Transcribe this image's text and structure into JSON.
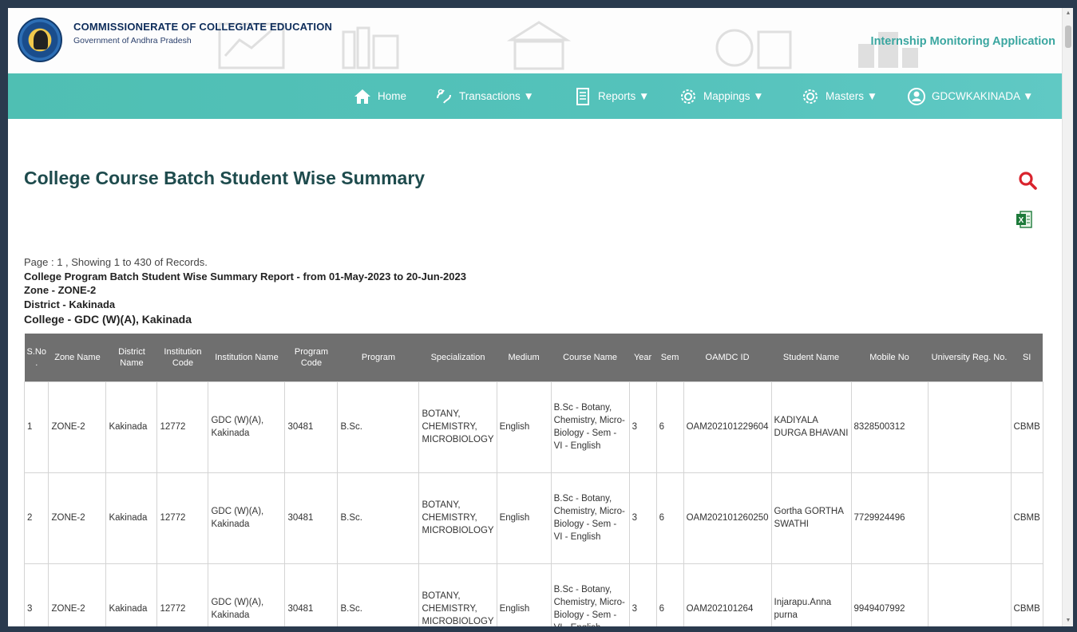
{
  "header": {
    "org_title": "COMMISSIONERATE OF COLLEGIATE EDUCATION",
    "org_subtitle": "Government of Andhra Pradesh",
    "app_title": "Internship Monitoring Application"
  },
  "nav": {
    "items": [
      {
        "label": "Home",
        "icon": "home-icon"
      },
      {
        "label": "Transactions ▼",
        "icon": "transactions-icon"
      },
      {
        "label": "Reports ▼",
        "icon": "reports-icon"
      },
      {
        "label": "Mappings ▼",
        "icon": "gear-icon"
      },
      {
        "label": "Masters ▼",
        "icon": "gear-icon"
      },
      {
        "label": "GDCWKAKINADA ▼",
        "icon": "user-icon"
      }
    ]
  },
  "page": {
    "title": "College Course Batch Student Wise Summary",
    "records_info": "Page : 1 , Showing 1 to 430 of Records.",
    "report_title": "College Program Batch Student Wise Summary Report - from 01-May-2023 to 20-Jun-2023",
    "zone": "Zone - ZONE-2",
    "district": "District - Kakinada",
    "college": "College - GDC (W)(A), Kakinada"
  },
  "table": {
    "headers": [
      "S.No .",
      "Zone Name",
      "District Name",
      "Institution Code",
      "Institution Name",
      "Program Code",
      "Program",
      "Specialization",
      "Medium",
      "Course Name",
      "Year",
      "Sem",
      "OAMDC ID",
      "Student Name",
      "Mobile No",
      "University Reg. No.",
      "SI"
    ],
    "rows": [
      [
        "1",
        "ZONE-2",
        "Kakinada",
        "12772",
        "GDC (W)(A), Kakinada",
        "30481",
        "B.Sc.",
        "BOTANY, CHEMISTRY, MICROBIOLOGY",
        "English",
        "B.Sc - Botany, Chemistry, Micro-Biology - Sem - VI - English",
        "3",
        "6",
        "OAM202101229604",
        "KADIYALA DURGA BHAVANI",
        "8328500312",
        "",
        "CBMB"
      ],
      [
        "2",
        "ZONE-2",
        "Kakinada",
        "12772",
        "GDC (W)(A), Kakinada",
        "30481",
        "B.Sc.",
        "BOTANY, CHEMISTRY, MICROBIOLOGY",
        "English",
        "B.Sc - Botany, Chemistry, Micro-Biology - Sem - VI - English",
        "3",
        "6",
        "OAM202101260250",
        "Gortha GORTHA SWATHI",
        "7729924496",
        "",
        "CBMB"
      ],
      [
        "3",
        "ZONE-2",
        "Kakinada",
        "12772",
        "GDC (W)(A), Kakinada",
        "30481",
        "B.Sc.",
        "BOTANY, CHEMISTRY, MICROBIOLOGY",
        "English",
        "B.Sc - Botany, Chemistry, Micro-Biology - Sem - VI - English",
        "3",
        "6",
        "OAM202101264",
        "Injarapu.Anna purna",
        "9949407992",
        "",
        "CBMB"
      ]
    ]
  },
  "colors": {
    "nav_bg": "#54c2bb",
    "title": "#1e4b4d",
    "table_header": "#6f6f6f",
    "app_title": "#3aa6a0",
    "search_icon": "#d9232d"
  }
}
